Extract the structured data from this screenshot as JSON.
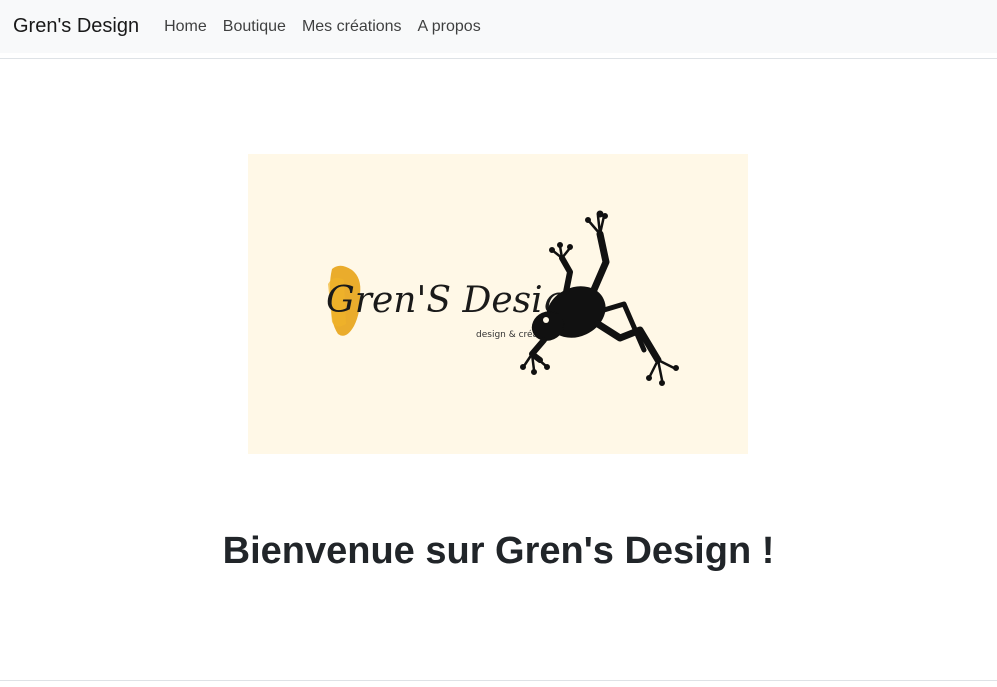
{
  "navbar": {
    "brand": "Gren's Design",
    "links": [
      "Home",
      "Boutique",
      "Mes créations",
      "A propos"
    ]
  },
  "banner": {
    "logo_title": "Gren'S Design",
    "logo_tagline": "design & création",
    "background_color": "#fff8e7",
    "accent_color": "#e8a317",
    "icon": "frog-icon"
  },
  "main": {
    "heading": "Bienvenue sur Gren's Design !"
  }
}
